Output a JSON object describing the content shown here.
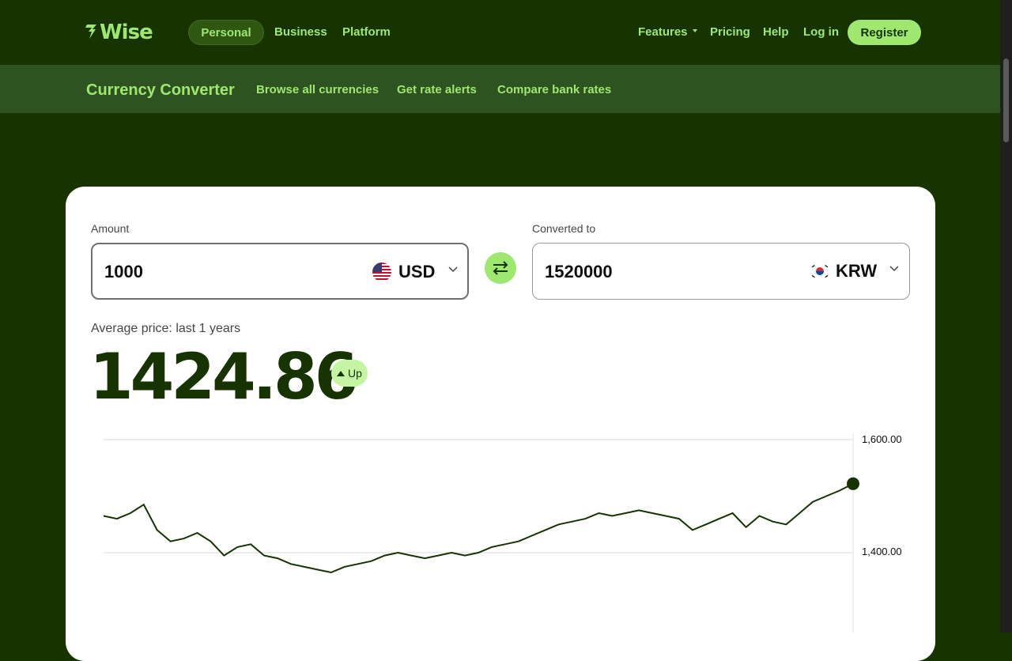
{
  "brand": {
    "name": "Wise",
    "accent": "#9fe870",
    "dark": "#163300"
  },
  "top_nav": {
    "left": [
      "Personal",
      "Business",
      "Platform"
    ],
    "features": "Features",
    "pricing": "Pricing",
    "help": "Help",
    "login": "Log in",
    "register": "Register"
  },
  "sub_nav": {
    "title": "Currency Converter",
    "links": [
      "Browse all currencies",
      "Get rate alerts",
      "Compare bank rates"
    ]
  },
  "converter": {
    "amount_label": "Amount",
    "amount_value": "1000",
    "from_currency": "USD",
    "from_flag": "us-flag-icon",
    "converted_label": "Converted to",
    "converted_value": "1520000",
    "to_currency": "KRW",
    "to_flag": "kr-flag-icon"
  },
  "summary": {
    "avg_label": "Average price: last 1 years",
    "avg_value": "1424.86",
    "trend": "Up"
  },
  "chart_data": {
    "type": "line",
    "series": [
      {
        "values": [
          1465,
          1460,
          1470,
          1485,
          1440,
          1420,
          1425,
          1435,
          1420,
          1395,
          1410,
          1415,
          1395,
          1390,
          1380,
          1375,
          1370,
          1365,
          1375,
          1380,
          1385,
          1395,
          1400,
          1395,
          1390,
          1395,
          1400,
          1395,
          1400,
          1410,
          1415,
          1420,
          1430,
          1440,
          1450,
          1455,
          1460,
          1470,
          1465,
          1470,
          1475,
          1470,
          1465,
          1460,
          1440,
          1450,
          1460,
          1470,
          1445,
          1465,
          1455,
          1450,
          1470,
          1490,
          1500,
          1510,
          1522
        ]
      }
    ],
    "y_ticks": [
      "1,600.00",
      "1,400.00"
    ],
    "ylim": [
      1300,
      1600
    ]
  },
  "colors": {
    "line": "#163300",
    "grid": "#d8d8d8"
  }
}
